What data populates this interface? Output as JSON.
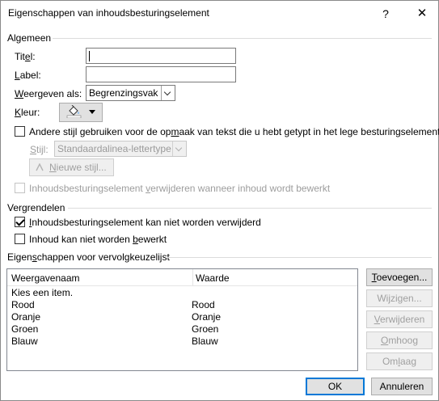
{
  "window": {
    "title": "Eigenschappen van inhoudsbesturingselement",
    "help_glyph": "?",
    "close_glyph": "✕"
  },
  "general": {
    "heading": "Algemeen",
    "title_label": {
      "pre": "Tit",
      "u": "e",
      "post": "l:"
    },
    "title_value": "",
    "label_label": {
      "pre": "",
      "u": "L",
      "post": "abel:"
    },
    "label_value": "",
    "display_label": {
      "pre": "",
      "u": "W",
      "post": "eergeven als:"
    },
    "display_value": "Begrenzingsvak",
    "color_label": {
      "pre": "",
      "u": "K",
      "post": "leur:"
    },
    "use_style": {
      "pre": "Andere stijl gebruiken voor de op",
      "u": "m",
      "post": "aak van tekst die u hebt getypt in het lege besturingselement",
      "checked": false
    },
    "style_label": {
      "pre": "",
      "u": "S",
      "post": "tijl:"
    },
    "style_value": "Standaardalinea-lettertype",
    "new_style": {
      "pre": "",
      "u": "N",
      "post": "ieuwe stijl..."
    },
    "remove_on_edit": {
      "pre": "Inhoudsbesturingselement ",
      "u": "v",
      "post": "erwijderen wanneer inhoud wordt bewerkt",
      "checked": false
    }
  },
  "locking": {
    "heading": "Vergrendelen",
    "cannot_delete": {
      "pre": "",
      "u": "I",
      "post": "nhoudsbesturingselement kan niet worden verwijderd",
      "checked": true
    },
    "cannot_edit": {
      "pre": "Inhoud kan niet worden ",
      "u": "b",
      "post": "ewerkt",
      "checked": false
    }
  },
  "dropdown": {
    "heading": {
      "pre": "Eigen",
      "u": "s",
      "post": "chappen voor vervolgkeuzelijst"
    },
    "columns": [
      "Weergavenaam",
      "Waarde"
    ],
    "rows": [
      [
        "Kies een item.",
        ""
      ],
      [
        "Rood",
        "Rood"
      ],
      [
        "Oranje",
        "Oranje"
      ],
      [
        "Groen",
        "Groen"
      ],
      [
        "Blauw",
        "Blauw"
      ]
    ],
    "buttons": {
      "add": {
        "pre": "",
        "u": "T",
        "post": "oevoegen..."
      },
      "modify": {
        "pre": "Wi",
        "u": "j",
        "post": "zigen..."
      },
      "remove": {
        "pre": "",
        "u": "V",
        "post": "erwijderen"
      },
      "up": {
        "pre": "",
        "u": "O",
        "post": "mhoog"
      },
      "down": {
        "pre": "Om",
        "u": "l",
        "post": "aag"
      }
    }
  },
  "footer": {
    "ok": "OK",
    "cancel": "Annuleren"
  },
  "colors": {
    "accent": "#0078d7",
    "disabled_text": "#9d9d9d"
  }
}
